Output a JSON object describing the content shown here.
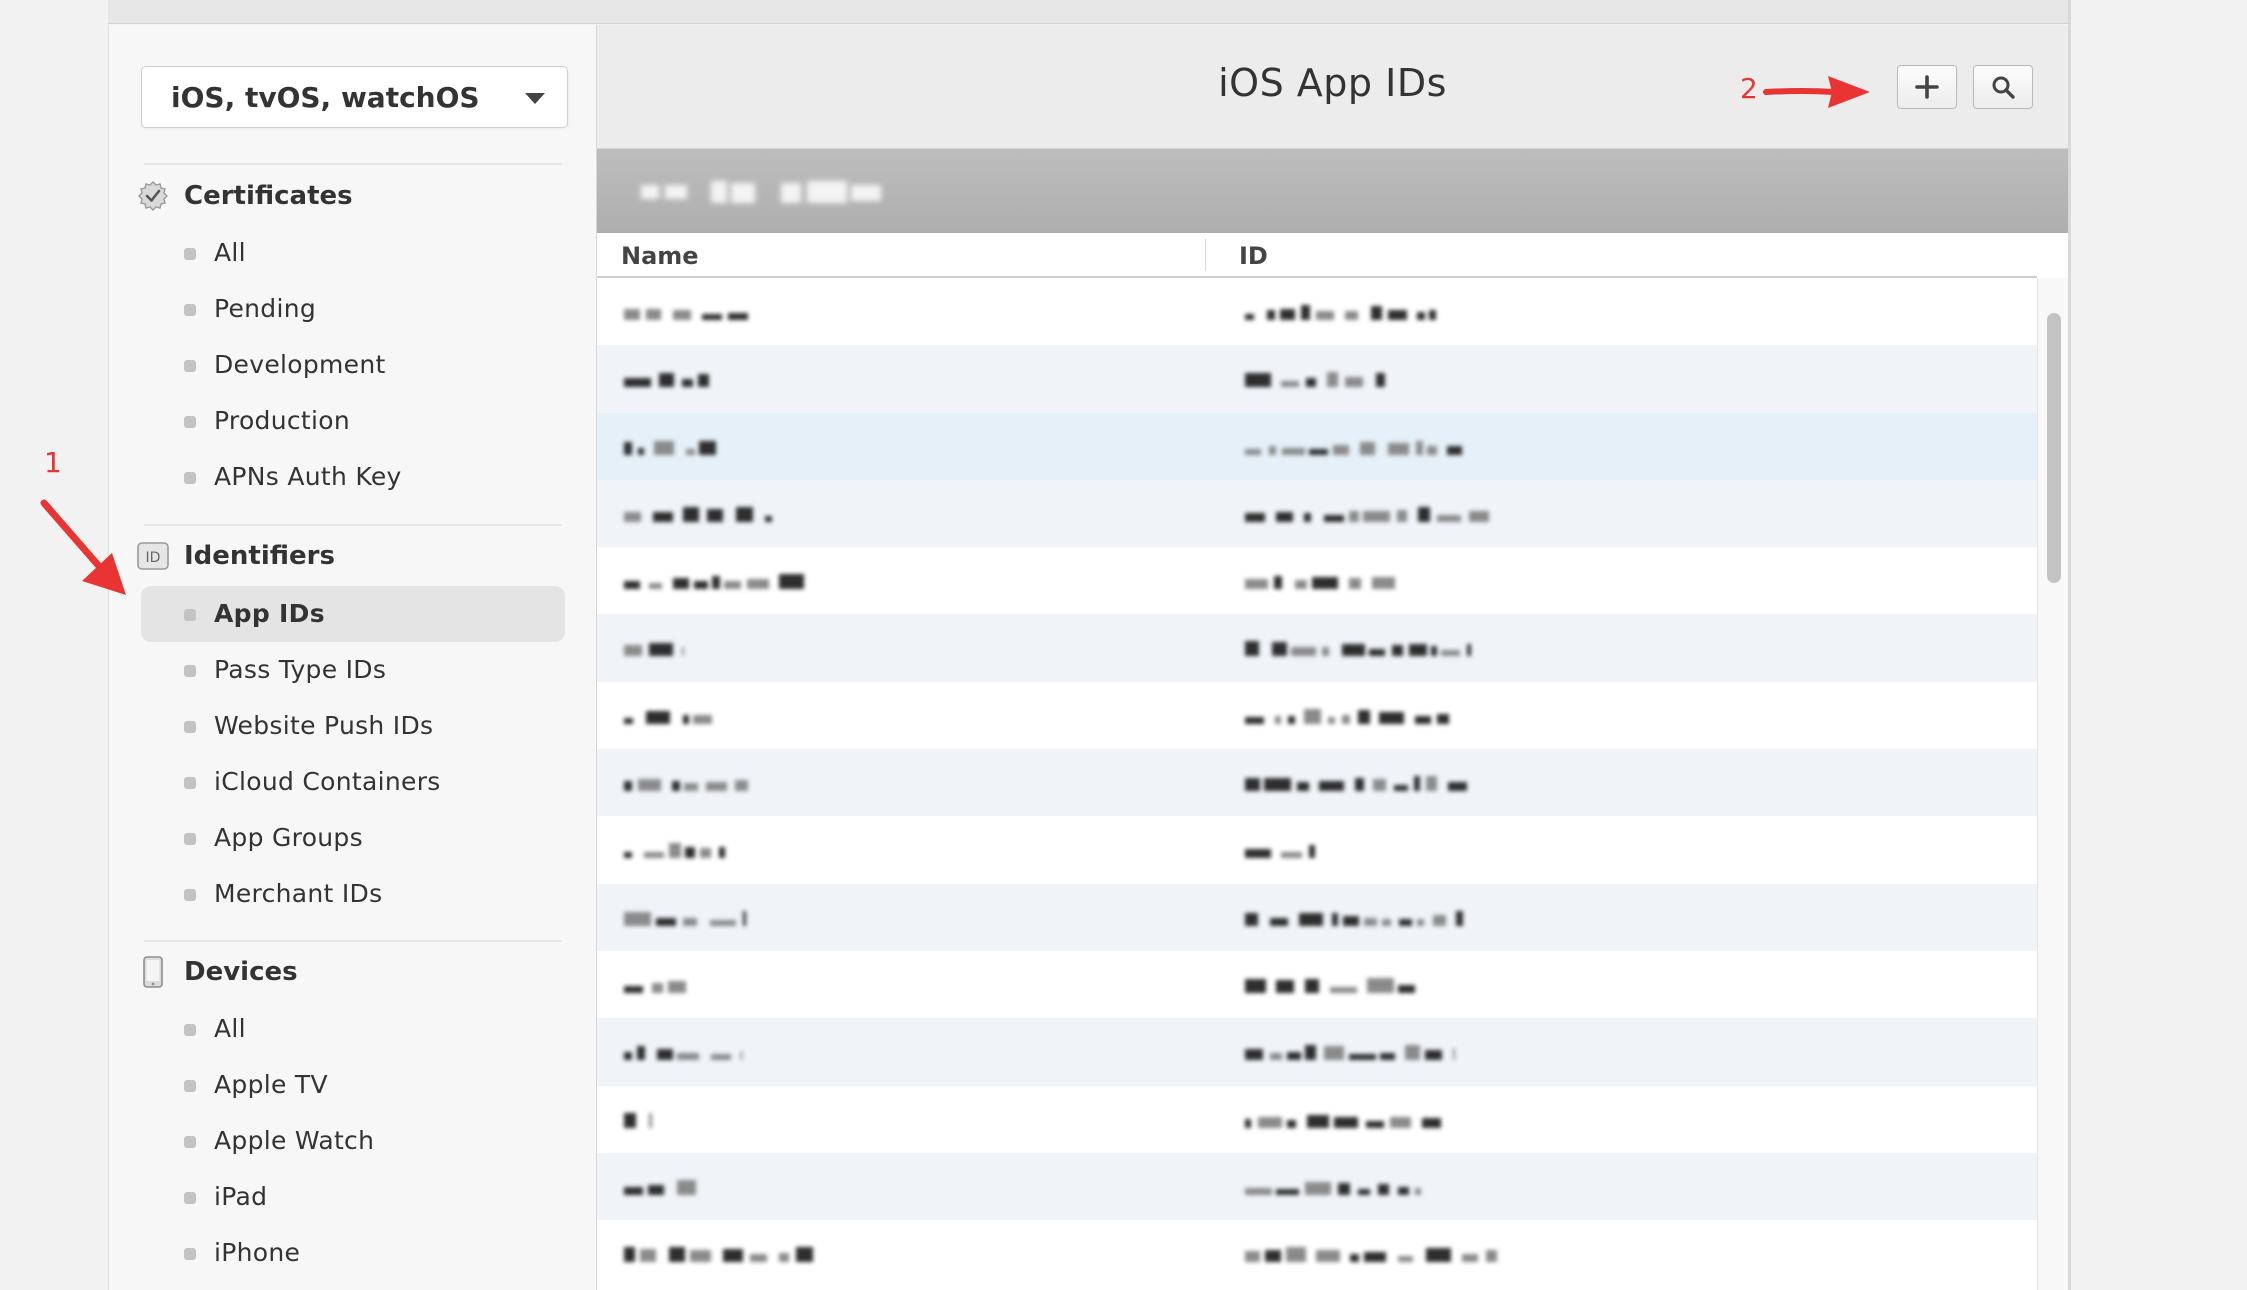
{
  "sidebar": {
    "platform_select": "iOS, tvOS, watchOS",
    "sections": [
      {
        "title": "Certificates",
        "icon": "certificate-badge-icon",
        "items": [
          "All",
          "Pending",
          "Development",
          "Production",
          "APNs Auth Key"
        ]
      },
      {
        "title": "Identifiers",
        "icon": "id-badge-icon",
        "items": [
          "App IDs",
          "Pass Type IDs",
          "Website Push IDs",
          "iCloud Containers",
          "App Groups",
          "Merchant IDs"
        ],
        "active_item": "App IDs"
      },
      {
        "title": "Devices",
        "icon": "device-phone-icon",
        "items": [
          "All",
          "Apple TV",
          "Apple Watch",
          "iPad",
          "iPhone"
        ]
      }
    ]
  },
  "main": {
    "title": "iOS App IDs",
    "toolbar": {
      "add_icon": "plus-icon",
      "search_icon": "search-icon"
    },
    "columns": {
      "name": "Name",
      "id": "ID"
    },
    "rows_count_visible": 15,
    "highlighted_row": 3
  },
  "annotations": {
    "marker_1": "1",
    "marker_2": "2",
    "color": "#ea3434"
  },
  "colors": {
    "active_item_bg": "#e4e4e4",
    "row_alt_bg": "#f0f4f9",
    "row_highlight_bg": "#e5f0f8",
    "header_bg": "#ececec"
  }
}
